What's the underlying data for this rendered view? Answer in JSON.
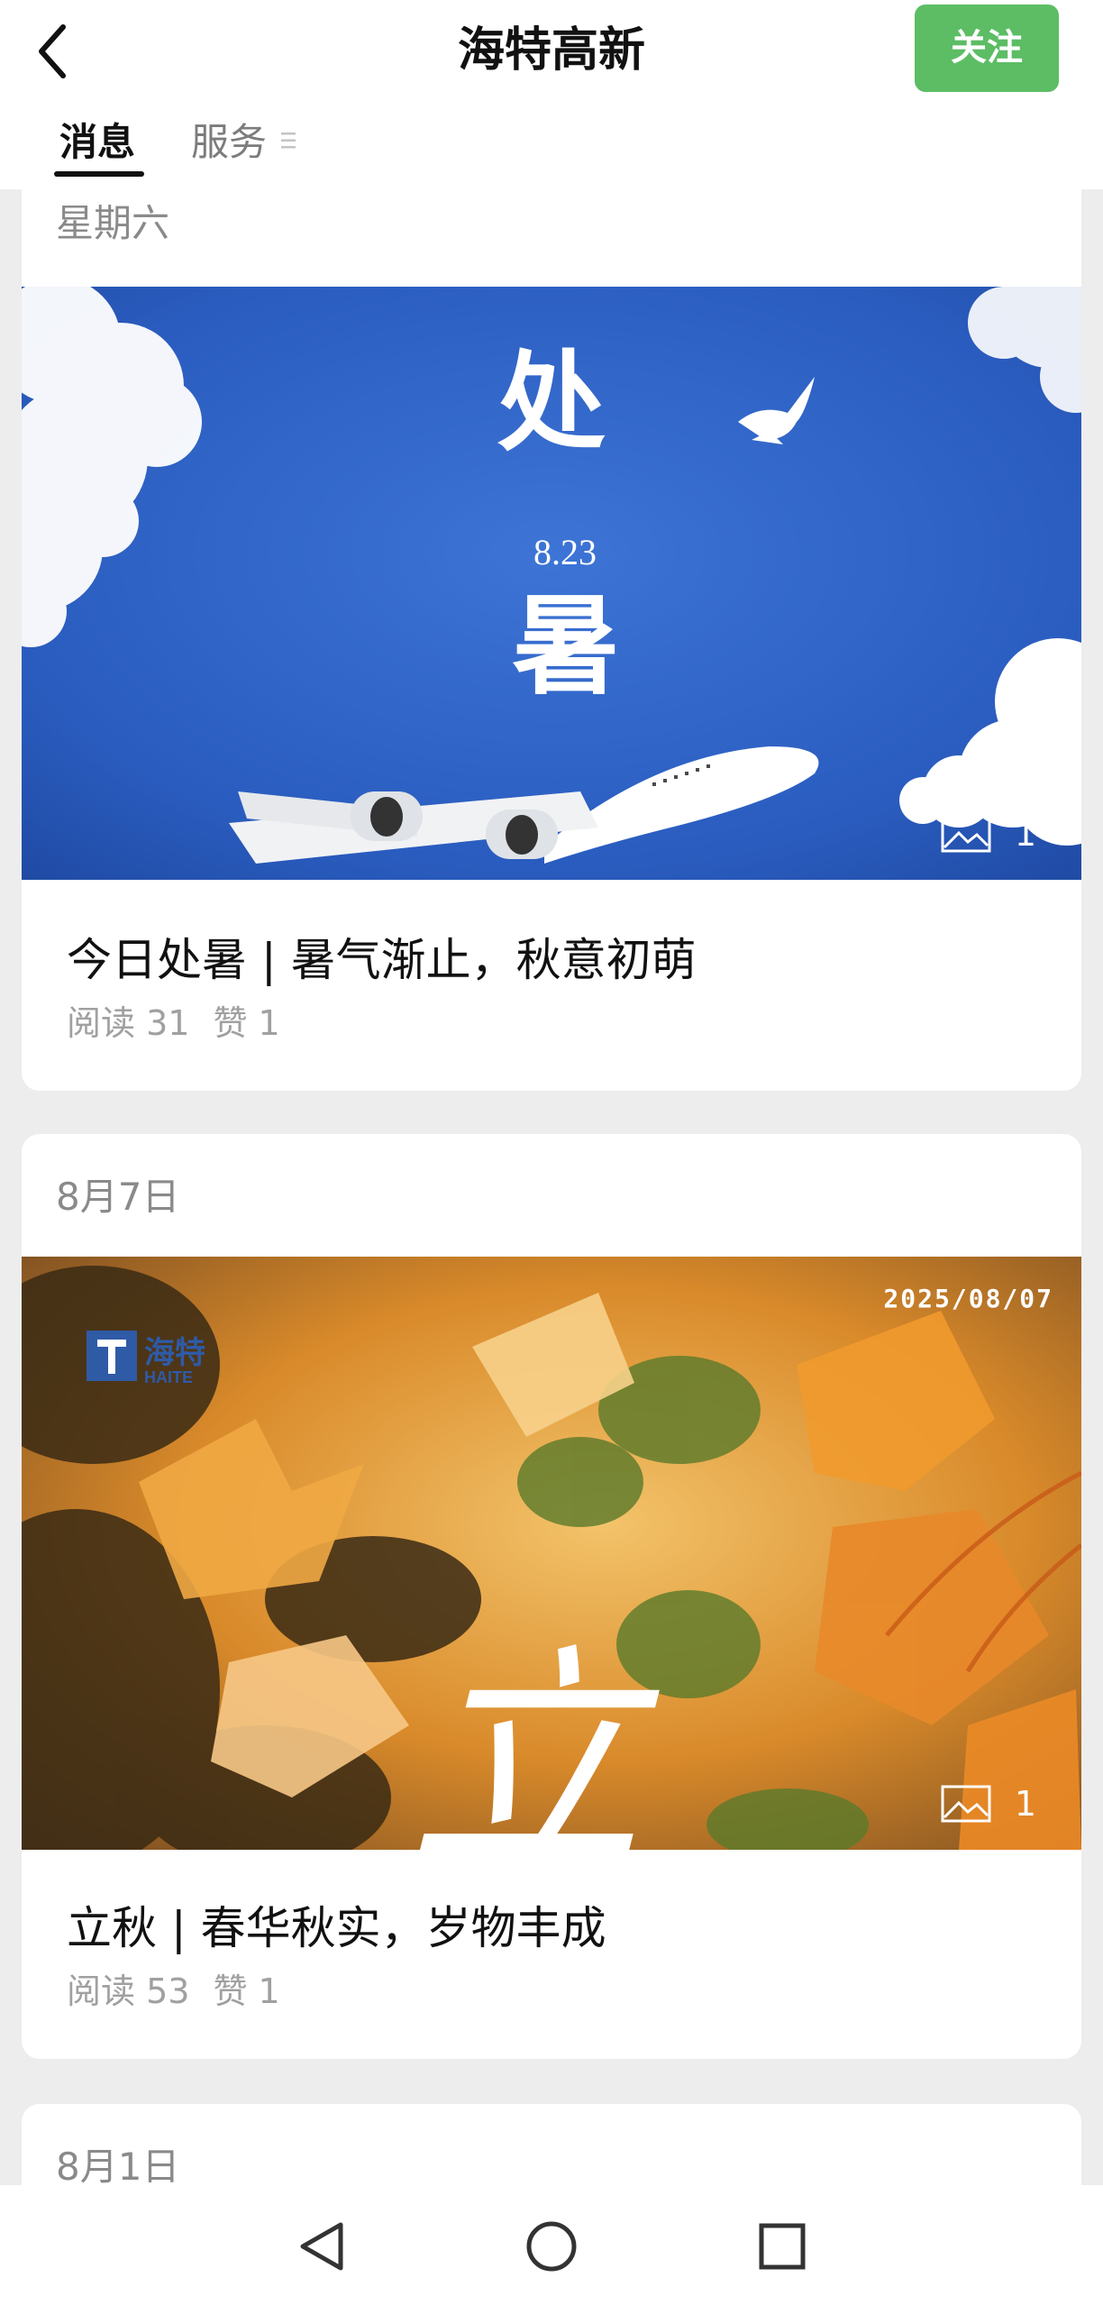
{
  "header": {
    "title": "海特高新",
    "follow_label": "关注"
  },
  "tabs": [
    {
      "label": "消息",
      "active": true
    },
    {
      "label": "服务",
      "active": false
    }
  ],
  "feed": [
    {
      "date": "星期六",
      "cover": {
        "char_top": "处",
        "date_text": "8.23",
        "char_bottom": "暑",
        "image_count": "1"
      },
      "title": "今日处暑 | 暑气渐止，秋意初萌",
      "reads": "阅读 31",
      "likes": "赞 1"
    },
    {
      "date": "8月7日",
      "cover": {
        "logo_text": "海特",
        "logo_sub": "HAITE",
        "stamp": "2025/08/07",
        "char": "立",
        "image_count": "1"
      },
      "title": "立秋 | 春华秋实，岁物丰成",
      "reads": "阅读 53",
      "likes": "赞 1"
    },
    {
      "date": "8月1日"
    }
  ],
  "colors": {
    "accent_green": "#5cbd64",
    "sky_blue": "#2f63c4",
    "autumn_orange": "#e89a2e"
  },
  "icons": {
    "back": "chevron-left-icon",
    "image_count": "image-icon",
    "nav_back": "triangle-back-icon",
    "nav_home": "circle-home-icon",
    "nav_recent": "square-recent-icon"
  }
}
